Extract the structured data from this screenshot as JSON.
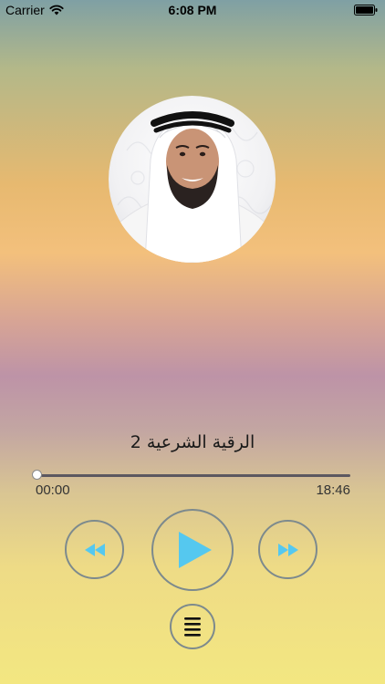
{
  "status_bar": {
    "carrier": "Carrier",
    "time": "6:08 PM"
  },
  "player": {
    "track_title": "الرقية الشرعية 2",
    "elapsed": "00:00",
    "duration": "18:46",
    "progress_fraction": 0.0
  },
  "controls": {
    "rewind_icon": "rewind-icon",
    "play_icon": "play-icon",
    "forward_icon": "fast-forward-icon",
    "playlist_icon": "list-icon"
  },
  "colors": {
    "accent": "#55c8ef",
    "control_border": "#7d8a8d"
  }
}
